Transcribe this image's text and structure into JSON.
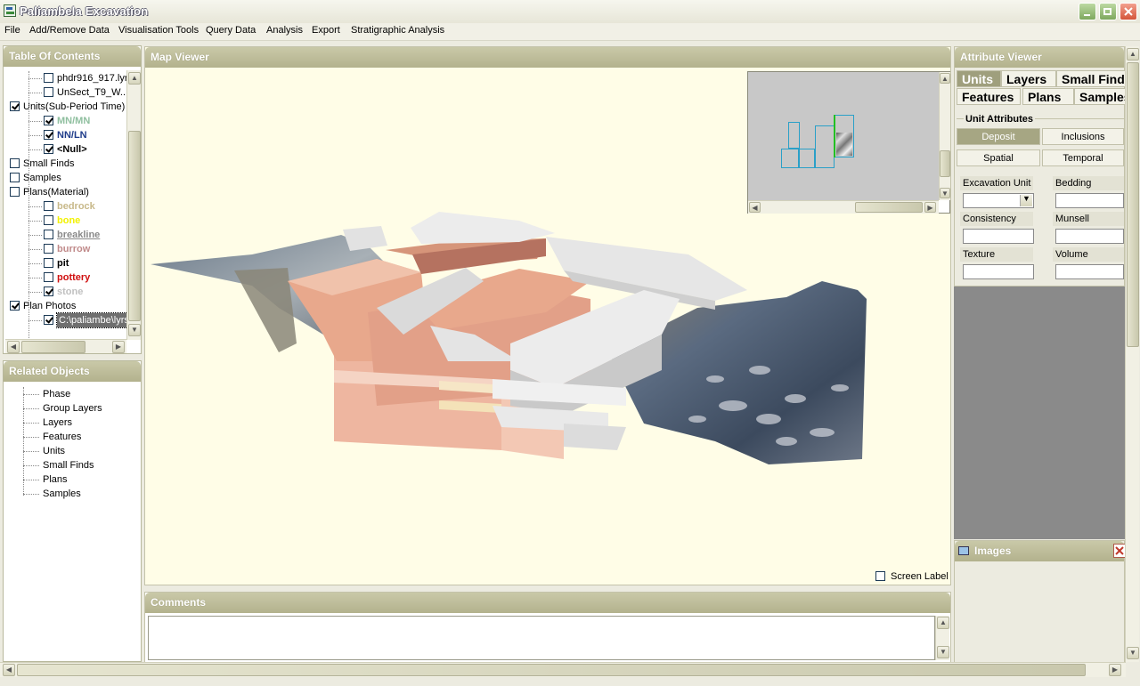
{
  "window": {
    "title": "Paliambela Excavation"
  },
  "menu": [
    "File",
    "Add/Remove Data",
    "Visualisation Tools",
    "Query Data",
    "Analysis",
    "Export",
    "Stratigraphic Analysis"
  ],
  "toc": {
    "title": "Table Of Contents",
    "items": [
      {
        "label": "phdr916_917.lyr",
        "checked": false,
        "level": 1,
        "color": "#000000",
        "bold": false
      },
      {
        "label": "UnSect_T9_W...",
        "checked": false,
        "level": 1,
        "color": "#000000",
        "bold": false
      },
      {
        "label": "Units(Sub-Period Time)",
        "checked": true,
        "level": 0,
        "color": "#000000",
        "bold": false
      },
      {
        "label": "MN/MN",
        "checked": true,
        "level": 1,
        "color": "#8fbf9f",
        "bold": true
      },
      {
        "label": "NN/LN",
        "checked": true,
        "level": 1,
        "color": "#1f3c8a",
        "bold": true
      },
      {
        "label": "<Null>",
        "checked": true,
        "level": 1,
        "color": "#000000",
        "bold": true
      },
      {
        "label": "Small Finds",
        "checked": false,
        "level": 0,
        "color": "#000000",
        "bold": false
      },
      {
        "label": "Samples",
        "checked": false,
        "level": 0,
        "color": "#000000",
        "bold": false
      },
      {
        "label": "Plans(Material)",
        "checked": false,
        "level": 0,
        "color": "#000000",
        "bold": false
      },
      {
        "label": "bedrock",
        "checked": false,
        "level": 1,
        "color": "#c8b98a",
        "bold": true
      },
      {
        "label": "bone",
        "checked": false,
        "level": 1,
        "color": "#f2f200",
        "bold": true
      },
      {
        "label": "breakline",
        "checked": false,
        "level": 1,
        "color": "#8a8a8a",
        "bold": true,
        "underline": true
      },
      {
        "label": "burrow",
        "checked": false,
        "level": 1,
        "color": "#c08a8a",
        "bold": true
      },
      {
        "label": "pit",
        "checked": false,
        "level": 1,
        "color": "#000000",
        "bold": true
      },
      {
        "label": "pottery",
        "checked": false,
        "level": 1,
        "color": "#d01010",
        "bold": true
      },
      {
        "label": "stone",
        "checked": true,
        "level": 1,
        "color": "#c0c0c0",
        "bold": true
      },
      {
        "label": "Plan Photos",
        "checked": true,
        "level": 0,
        "color": "#000000",
        "bold": false
      },
      {
        "label": "C:\\paliambe\\lyrs",
        "checked": true,
        "level": 1,
        "color": "#ffffff",
        "bold": false,
        "selected": true
      }
    ]
  },
  "related": {
    "title": "Related Objects",
    "items": [
      "Phase",
      "Group Layers",
      "Layers",
      "Features",
      "Units",
      "Small Finds",
      "Plans",
      "Samples"
    ]
  },
  "map": {
    "title": "Map Viewer",
    "screen_label": "Screen Label",
    "screen_label_checked": false
  },
  "comments": {
    "title": "Comments"
  },
  "attribute_viewer": {
    "title": "Attribute Viewer",
    "tabs_row1": [
      "Units",
      "Layers",
      "Small Finds"
    ],
    "tabs_row2": [
      "Features",
      "Plans",
      "Samples"
    ],
    "active_tab": "Units",
    "group_label": "Unit Attributes",
    "sub_buttons": [
      "Deposit",
      "Inclusions",
      "Spatial",
      "Temporal"
    ],
    "active_sub": "Deposit",
    "fields": [
      "Excavation Unit",
      "Bedding",
      "Consistency",
      "Munsell",
      "Texture",
      "Volume"
    ]
  },
  "images": {
    "title": "Images"
  },
  "colors": {
    "map_background": "#fffde7",
    "panel_header": "#b5b48f",
    "unit_block": "#e8a88c",
    "unit_block_top": "#f0c2ab",
    "roof_gray": "#e6e6e6"
  }
}
